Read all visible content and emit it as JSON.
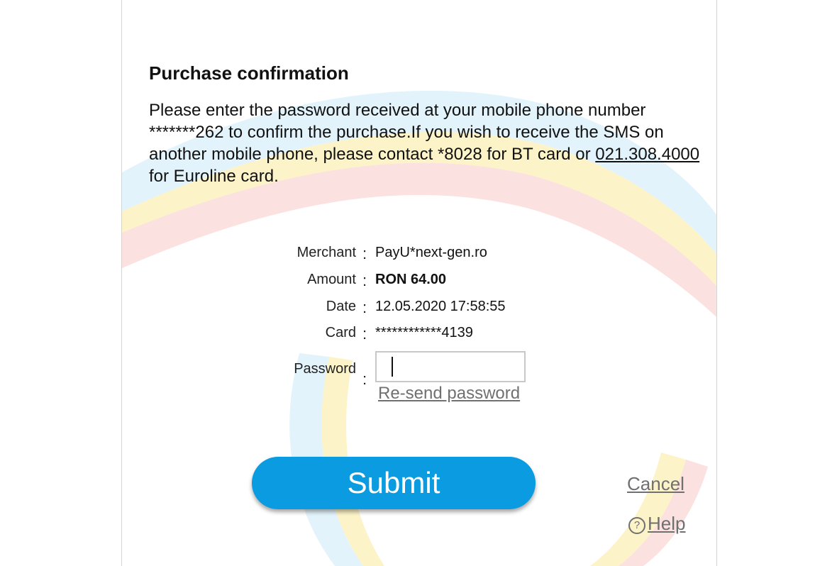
{
  "page": {
    "title": "Purchase confirmation",
    "message_before_link": "Please enter the password received at your mobile phone number *******262 to confirm the purchase.If you wish to receive the SMS on another mobile phone, please contact *8028 for BT card or ",
    "phone_link": "021.308.4000",
    "message_after_link": " for Euroline card."
  },
  "details": {
    "separator": ":",
    "merchant_label": "Merchant",
    "merchant_value": "PayU*next-gen.ro",
    "amount_label": "Amount",
    "amount_value": "RON 64.00",
    "date_label": "Date",
    "date_value": "12.05.2020 17:58:55",
    "card_label": "Card",
    "card_value": "************4139",
    "password_label": "Password",
    "password_value": ""
  },
  "actions": {
    "resend_label": "Re-send password",
    "submit_label": "Submit",
    "cancel_label": "Cancel",
    "help_label": "Help",
    "help_icon_glyph": "?"
  },
  "colors": {
    "accent": "#0a9be0",
    "link_gray": "#707070",
    "swoosh_blue": "#e3f3fb",
    "swoosh_yellow": "#fdf3c8",
    "swoosh_red": "#fbe1df"
  }
}
